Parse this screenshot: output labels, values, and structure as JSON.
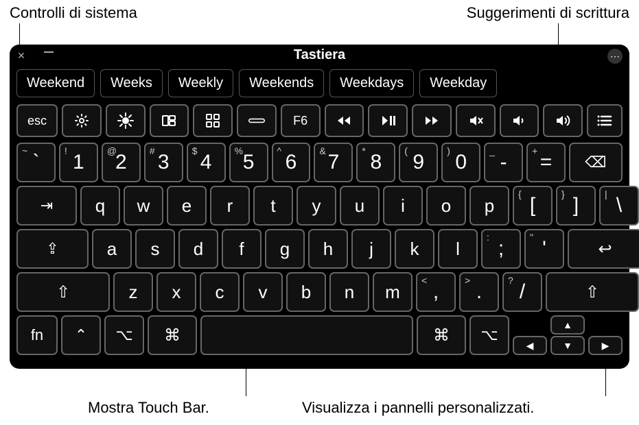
{
  "callouts": {
    "top_left": "Controlli di sistema",
    "top_right": "Suggerimenti di scrittura",
    "bottom_left": "Mostra Touch Bar.",
    "bottom_right": "Visualizza i pannelli personalizzati."
  },
  "window": {
    "title": "Tastiera"
  },
  "suggestions": [
    "Weekend",
    "Weeks",
    "Weekly",
    "Weekends",
    "Weekdays",
    "Weekday"
  ],
  "fnrow": {
    "esc": "esc",
    "f6": "F6"
  },
  "row1": {
    "tilde_sup": "~",
    "tilde_main": "`",
    "k1_sup": "!",
    "k1": "1",
    "k2_sup": "@",
    "k2": "2",
    "k3_sup": "#",
    "k3": "3",
    "k4_sup": "$",
    "k4": "4",
    "k5_sup": "%",
    "k5": "5",
    "k6_sup": "^",
    "k6": "6",
    "k7_sup": "&",
    "k7": "7",
    "k8_sup": "*",
    "k8": "8",
    "k9_sup": "(",
    "k9": "9",
    "k0_sup": ")",
    "k0": "0",
    "dash_sup": "_",
    "dash": "-",
    "eq_sup": "+",
    "eq": "=",
    "bksp": "⌫"
  },
  "row2": {
    "tab": "⇥",
    "q": "q",
    "w": "w",
    "e": "e",
    "r": "r",
    "t": "t",
    "y": "y",
    "u": "u",
    "i": "i",
    "o": "o",
    "p": "p",
    "lb_sup": "{",
    "lb": "[",
    "rb_sup": "}",
    "rb": "]",
    "bs_sup": "|",
    "bs": "\\"
  },
  "row3": {
    "caps": "⇪",
    "a": "a",
    "s": "s",
    "d": "d",
    "f": "f",
    "g": "g",
    "h": "h",
    "j": "j",
    "k": "k",
    "l": "l",
    "semi_sup": ":",
    "semi": ";",
    "quote_sup": "\"",
    "quote": "'",
    "enter": "↩"
  },
  "row4": {
    "shift": "⇧",
    "z": "z",
    "x": "x",
    "c": "c",
    "v": "v",
    "b": "b",
    "n": "n",
    "m": "m",
    "comma_sup": "<",
    "comma": ",",
    "dot_sup": ">",
    "dot": ".",
    "slash_sup": "?",
    "slash": "/"
  },
  "row5": {
    "fn": "fn",
    "ctrl": "⌃",
    "opt": "⌥",
    "cmd": "⌘",
    "up": "▲",
    "down": "▼",
    "left": "◀",
    "right": "▶"
  }
}
